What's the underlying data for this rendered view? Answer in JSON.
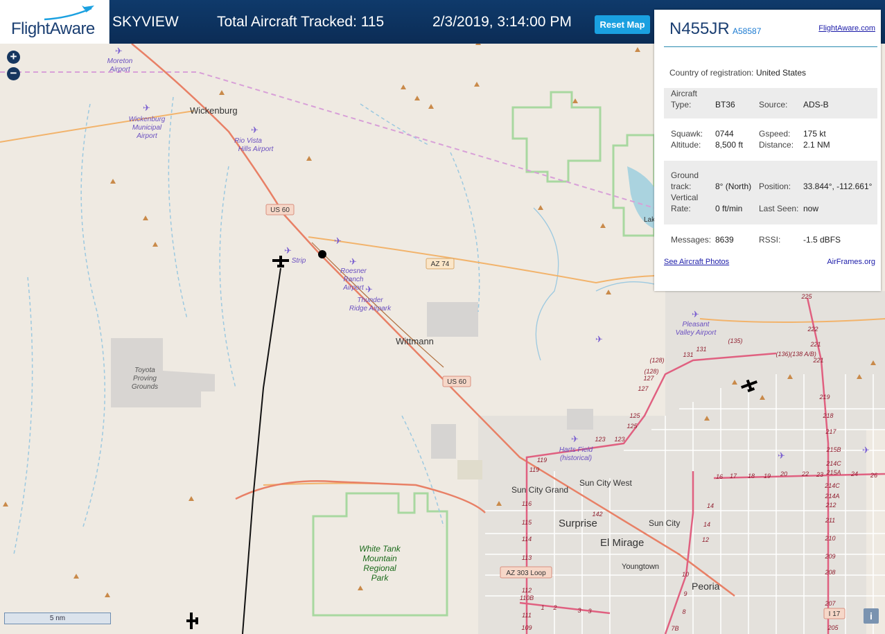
{
  "header": {
    "logo_text": "FlightAware",
    "app_name": "SKYVIEW",
    "total_label": "Total Aircraft Tracked: 115",
    "datetime": "2/3/2019, 3:14:00 PM",
    "reset_label": "Reset Map"
  },
  "zoom": {
    "in": "+",
    "out": "−"
  },
  "panel": {
    "ident": "N455JR",
    "hex": "A58587",
    "site_link": "FlightAware.com",
    "country_label": "Country of registration:",
    "country_value": "United States",
    "aircraft_label1": "Aircraft",
    "aircraft_label2": "Type:",
    "type_value": "BT36",
    "source_label": "Source:",
    "source_value": "ADS-B",
    "squawk_label": "Squawk:",
    "squawk_value": "0744",
    "altitude_label": "Altitude:",
    "altitude_value": "8,500 ft",
    "gspeed_label": "Gspeed:",
    "gspeed_value": "175 kt",
    "distance_label": "Distance:",
    "distance_value": "2.1 NM",
    "ground_label1": "Ground",
    "ground_label2": "track:",
    "track_value": "8° (North)",
    "position_label": "Position:",
    "position_value": "33.844°, -112.661°",
    "vrate_label1": "Vertical",
    "vrate_label2": "Rate:",
    "vrate_value": "0 ft/min",
    "lastseen_label": "Last Seen:",
    "lastseen_value": "now",
    "messages_label": "Messages:",
    "messages_value": "8639",
    "rssi_label": "RSSI:",
    "rssi_value": "-1.5 dBFS",
    "photos_link": "See Aircraft Photos",
    "airframes_link": "AirFrames.org"
  },
  "scale_label": "5 nm",
  "info_label": "i",
  "map": {
    "places": [
      "Wickenburg",
      "Wittmann",
      "Surprise",
      "El Mirage",
      "Sun City",
      "Sun City West",
      "Sun City Grand",
      "Youngtown",
      "Peoria",
      "Lak"
    ],
    "airports": [
      "Moreton",
      "Airport",
      "Wickenburg",
      "Municipal",
      "Airport",
      "Rio Vista",
      "Hills Airport",
      "Strip",
      "Roesner",
      "Ranch",
      "Airport",
      "Thunder",
      "Ridge Airpark",
      "Pleasant",
      "Valley Airport",
      "Harts Field",
      "(historical)"
    ],
    "parks": [
      "White Tank",
      "Mountain",
      "Regional",
      "Park"
    ],
    "grounds": [
      "Toyota",
      "Proving",
      "Grounds"
    ],
    "shields": [
      "US 60",
      "AZ 74",
      "US 60",
      "AZ 303 Loop",
      "I 17"
    ],
    "exit_numbers": [
      "225",
      "222",
      "221",
      "221",
      "219",
      "218",
      "217",
      "215B",
      "214C",
      "215A",
      "214C",
      "214A",
      "212",
      "211",
      "210",
      "209",
      "208",
      "207",
      "205",
      "131",
      "131",
      "(135)",
      "(136)",
      "(138 A/B)",
      "(128)",
      "(128)",
      "127",
      "127",
      "125",
      "125",
      "123",
      "123",
      "119",
      "119",
      "116",
      "115",
      "114",
      "113",
      "112",
      "110B",
      "111",
      "109",
      "142",
      "1",
      "2",
      "3",
      "3",
      "16",
      "17",
      "18",
      "19",
      "20",
      "22",
      "23",
      "24",
      "26",
      "14",
      "14",
      "12",
      "10",
      "9",
      "8",
      "7B"
    ]
  },
  "colors": {
    "header_bg": "#0f3a6b",
    "accent": "#1aa0e0",
    "map_bg": "#efeae2",
    "track_line": "#111111"
  }
}
